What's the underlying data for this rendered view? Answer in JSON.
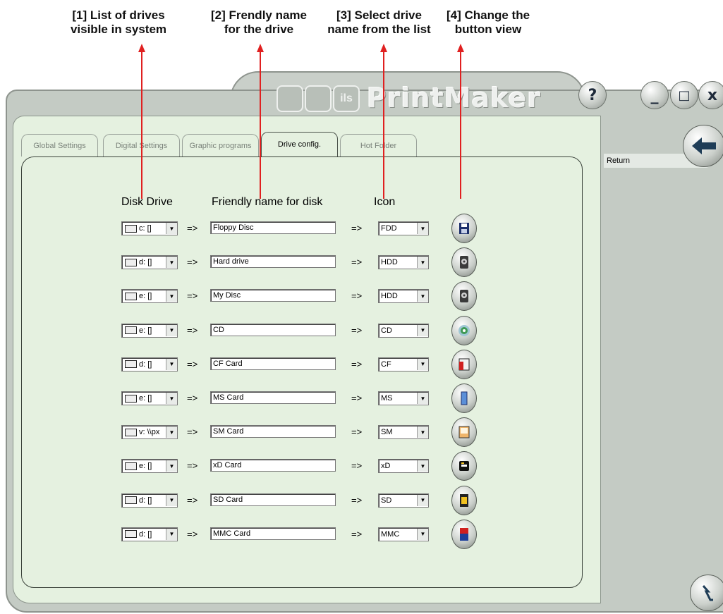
{
  "annotations": [
    {
      "label_line1": "[1] List of drives",
      "label_line2": "visible in system"
    },
    {
      "label_line1": "[2] Frendly name",
      "label_line2": "for the drive"
    },
    {
      "label_line1": "[3] Select drive",
      "label_line2": "name from the list"
    },
    {
      "label_line1": "[4] Change the",
      "label_line2": "button view"
    }
  ],
  "app": {
    "title": "PrintMaker",
    "logo_text": "ils",
    "help_label": "?",
    "minimize_label": "_",
    "maximize_label": "□",
    "close_label": "x"
  },
  "tabs": [
    {
      "label": "Global Settings",
      "active": false
    },
    {
      "label": "Digital Settings",
      "active": false
    },
    {
      "label": "Graphic programs",
      "active": false
    },
    {
      "label": "Drive config.",
      "active": true
    },
    {
      "label": "Hot Folder",
      "active": false
    }
  ],
  "sidebar": {
    "return_label": "Return"
  },
  "table": {
    "headers": {
      "disk": "Disk Drive",
      "name": "Friendly name for disk",
      "icon": "Icon"
    },
    "arrow": "=>",
    "rows": [
      {
        "drive": "c: []",
        "name": "Floppy Disc",
        "icon": "FDD",
        "icon_kind": "floppy-icon"
      },
      {
        "drive": "d: []",
        "name": "Hard drive",
        "icon": "HDD",
        "icon_kind": "hdd-icon"
      },
      {
        "drive": "e: []",
        "name": "My Disc",
        "icon": "HDD",
        "icon_kind": "hdd-icon"
      },
      {
        "drive": "e: []",
        "name": "CD",
        "icon": "CD",
        "icon_kind": "cd-icon"
      },
      {
        "drive": "d: []",
        "name": "CF Card",
        "icon": "CF",
        "icon_kind": "cf-card-icon"
      },
      {
        "drive": "e: []",
        "name": "MS Card",
        "icon": "MS",
        "icon_kind": "ms-card-icon"
      },
      {
        "drive": "v: \\\\px",
        "name": "SM Card",
        "icon": "SM",
        "icon_kind": "sm-card-icon"
      },
      {
        "drive": "e: []",
        "name": "xD Card",
        "icon": "xD",
        "icon_kind": "xd-card-icon"
      },
      {
        "drive": "d: []",
        "name": "SD Card",
        "icon": "SD",
        "icon_kind": "sd-card-icon"
      },
      {
        "drive": "d: []",
        "name": "MMC Card",
        "icon": "MMC",
        "icon_kind": "mmc-card-icon"
      }
    ]
  },
  "colors": {
    "accent_red": "#e02020",
    "panel_bg": "#e5f1e0",
    "frame": "#c4cbc4"
  }
}
